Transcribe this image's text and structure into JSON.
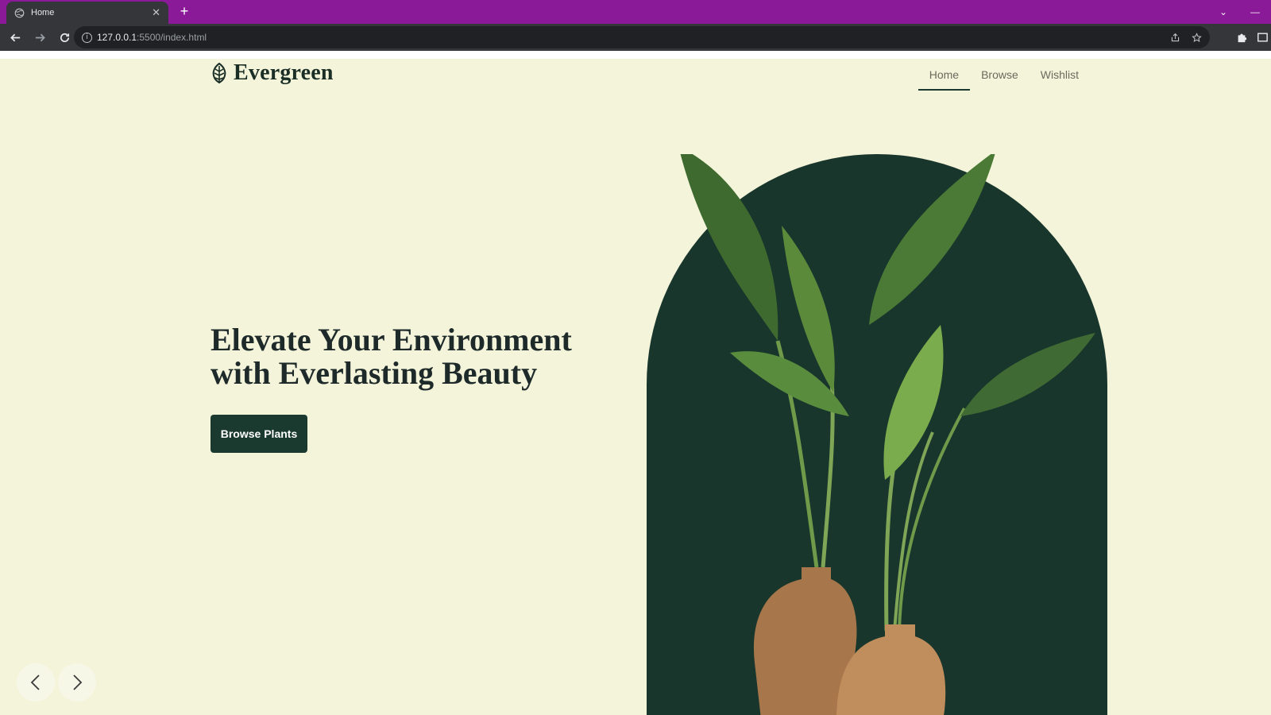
{
  "browser": {
    "tab_title": "Home",
    "tab_close": "✕",
    "new_tab": "+",
    "url_host": "127.0.0.1",
    "url_path": ":5500/index.html",
    "window_menu": "⌄",
    "window_minimize": "—"
  },
  "site": {
    "logo_text": "Evergreen",
    "nav": [
      {
        "label": "Home",
        "active": true
      },
      {
        "label": "Browse",
        "active": false
      },
      {
        "label": "Wishlist",
        "active": false
      }
    ],
    "hero": {
      "headline_line1": "Elevate Your Environment",
      "headline_line2": "with Everlasting Beauty",
      "cta_label": "Browse Plants"
    }
  },
  "colors": {
    "tab_bar": "#8b1a99",
    "page_bg": "#f4f4da",
    "brand_dark_green": "#18362c",
    "text_dark": "#1e2a2a"
  },
  "icons": {
    "tab": "globe-icon",
    "back": "arrow-left-icon",
    "forward": "arrow-right-icon",
    "reload": "reload-icon",
    "site_info": "info-icon",
    "share": "share-icon",
    "bookmark": "star-icon",
    "extensions": "puzzle-icon",
    "sidepanel": "sidepanel-icon",
    "logo": "leaf-icon",
    "carousel_prev": "chevron-left-icon",
    "carousel_next": "chevron-right-icon"
  }
}
